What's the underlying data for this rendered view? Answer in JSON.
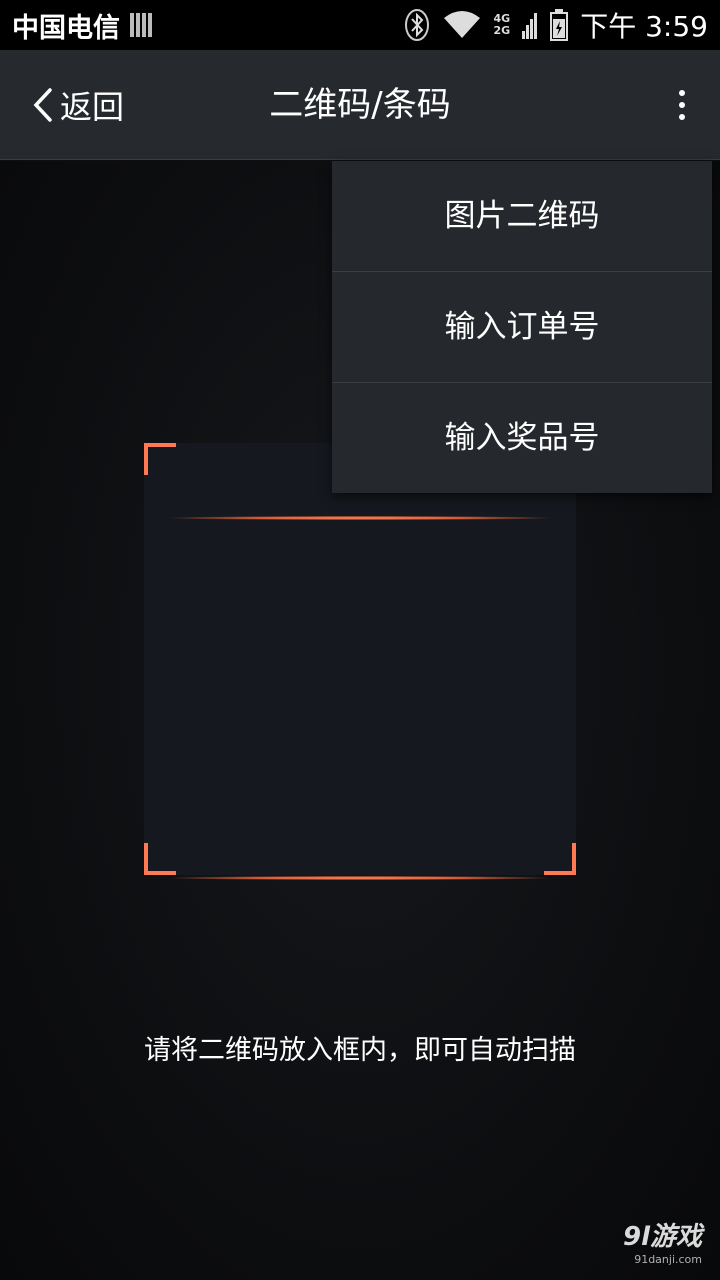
{
  "status_bar": {
    "carrier": "中国电信",
    "network_top": "4G",
    "network_bottom": "2G",
    "time": "下午 3:59"
  },
  "app_bar": {
    "back_label": "返回",
    "title": "二维码/条码"
  },
  "menu": {
    "items": [
      {
        "label": "图片二维码"
      },
      {
        "label": "输入订单号"
      },
      {
        "label": "输入奖品号"
      }
    ]
  },
  "scanner": {
    "hint": "请将二维码放入框内，即可自动扫描",
    "accent_color": "#ff7a52"
  },
  "watermark": {
    "brand": "9l游戏",
    "site": "91danji.com"
  }
}
